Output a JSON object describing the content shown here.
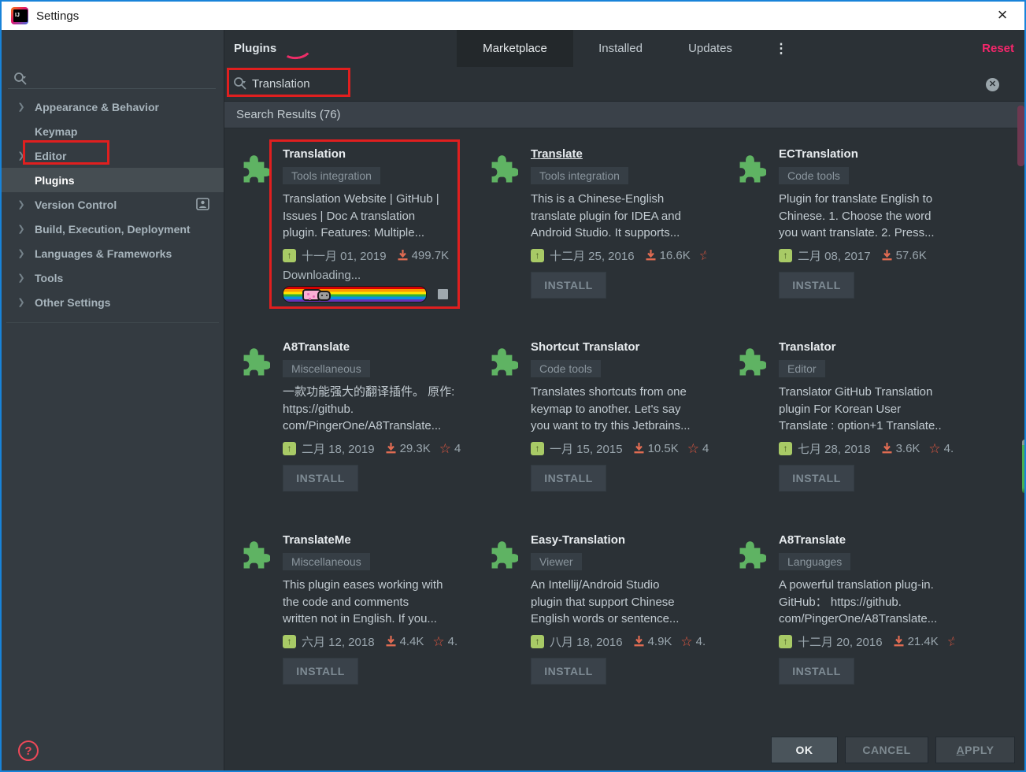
{
  "window": {
    "title": "Settings"
  },
  "icons": {
    "close": "×",
    "kebab": "⋮",
    "clear": "✕",
    "chevron": "❯",
    "help": "?",
    "update_arrow": "↑",
    "star": "☆"
  },
  "colors": {
    "window_border_blue": "#1883D9",
    "annotation_red": "#E01F1F",
    "annotation_pink_arc": "#EE2D68",
    "reset_pink": "#F5266B",
    "plugin_green": "#5FB363",
    "update_chip_green": "#A8CA66",
    "downloads_orange": "#E06B52",
    "star_orange": "#E25740",
    "scrollbar_maroon": "#6E3850",
    "help_pink": "#EE4858"
  },
  "sidebar": {
    "items": [
      {
        "label": "Appearance & Behavior",
        "chevron": true,
        "selected": false,
        "badge": false
      },
      {
        "label": "Keymap",
        "chevron": false,
        "selected": false,
        "badge": false
      },
      {
        "label": "Editor",
        "chevron": true,
        "selected": false,
        "badge": false
      },
      {
        "label": "Plugins",
        "chevron": false,
        "selected": true,
        "badge": false
      },
      {
        "label": "Version Control",
        "chevron": true,
        "selected": false,
        "badge": true
      },
      {
        "label": "Build, Execution, Deployment",
        "chevron": true,
        "selected": false,
        "badge": false
      },
      {
        "label": "Languages & Frameworks",
        "chevron": true,
        "selected": false,
        "badge": false
      },
      {
        "label": "Tools",
        "chevron": true,
        "selected": false,
        "badge": false
      },
      {
        "label": "Other Settings",
        "chevron": true,
        "selected": false,
        "badge": false
      }
    ]
  },
  "header": {
    "title": "Plugins",
    "tabs": [
      {
        "label": "Marketplace",
        "selected": true
      },
      {
        "label": "Installed",
        "selected": false
      },
      {
        "label": "Updates",
        "selected": false
      }
    ],
    "reset_label": "Reset"
  },
  "search": {
    "value": "Translation",
    "results_label": "Search Results (76)"
  },
  "labels": {
    "install": "INSTALL"
  },
  "plugins": [
    {
      "name": "Translation",
      "tag": "Tools integration",
      "desc_lines": [
        "Translation Website | GitHub |",
        "Issues | Doc A translation",
        "plugin. Features: Multiple..."
      ],
      "date": "十一月 01, 2019",
      "downloads": "499.7K",
      "star": "none",
      "rating": "",
      "state": "downloading",
      "status_text": "Downloading...",
      "title_underline": false
    },
    {
      "name": "Translate",
      "tag": "Tools integration",
      "desc_lines": [
        "This is a Chinese-English",
        "translate plugin for IDEA and",
        "Android Studio. It supports..."
      ],
      "date": "十二月 25, 2016",
      "downloads": "16.6K",
      "star": "clipped",
      "rating": "",
      "state": "install",
      "status_text": "",
      "title_underline": true
    },
    {
      "name": "ECTranslation",
      "tag": "Code tools",
      "desc_lines": [
        "Plugin for translate English to",
        "Chinese. 1. Choose the word",
        "you want translate. 2. Press..."
      ],
      "date": "二月 08, 2017",
      "downloads": "57.6K",
      "star": "none",
      "rating": "",
      "state": "install",
      "status_text": "",
      "title_underline": false
    },
    {
      "name": "A8Translate",
      "tag": "Miscellaneous",
      "desc_lines": [
        "一款功能强大的翻译插件。 原作:",
        "https://github.",
        "com/PingerOne/A8Translate..."
      ],
      "date": "二月 18, 2019",
      "downloads": "29.3K",
      "star": "full",
      "rating": "4",
      "state": "install",
      "status_text": "",
      "title_underline": false
    },
    {
      "name": "Shortcut Translator",
      "tag": "Code tools",
      "desc_lines": [
        "Translates shortcuts from one",
        "keymap to another. Let's say",
        "you want to try this Jetbrains..."
      ],
      "date": "一月 15, 2015",
      "downloads": "10.5K",
      "star": "full",
      "rating": "4",
      "state": "install",
      "status_text": "",
      "title_underline": false
    },
    {
      "name": "Translator",
      "tag": "Editor",
      "desc_lines": [
        "Translator GitHub Translation",
        "plugin For Korean User",
        "Translate : option+1 Translate.."
      ],
      "date": "七月 28, 2018",
      "downloads": "3.6K",
      "star": "full",
      "rating": "4.",
      "state": "install",
      "status_text": "",
      "title_underline": false
    },
    {
      "name": "TranslateMe",
      "tag": "Miscellaneous",
      "desc_lines": [
        "This plugin eases working with",
        "the code and comments",
        "written not in English. If you..."
      ],
      "date": "六月 12, 2018",
      "downloads": "4.4K",
      "star": "full",
      "rating": "4.",
      "state": "install",
      "status_text": "",
      "title_underline": false
    },
    {
      "name": "Easy-Translation",
      "tag": "Viewer",
      "desc_lines": [
        "An Intellij/Android Studio",
        "plugin that support Chinese",
        "English words or sentence..."
      ],
      "date": "八月 18, 2016",
      "downloads": "4.9K",
      "star": "full",
      "rating": "4.",
      "state": "install",
      "status_text": "",
      "title_underline": false
    },
    {
      "name": "A8Translate",
      "tag": "Languages",
      "desc_lines": [
        "A powerful translation plug-in.",
        "GitHub： https://github.",
        "com/PingerOne/A8Translate..."
      ],
      "date": "十二月 20, 2016",
      "downloads": "21.4K",
      "star": "clipped",
      "rating": "",
      "state": "install",
      "status_text": "",
      "title_underline": false
    }
  ],
  "footer": {
    "ok": "OK",
    "cancel": "CANCEL",
    "apply": "APPLY"
  }
}
